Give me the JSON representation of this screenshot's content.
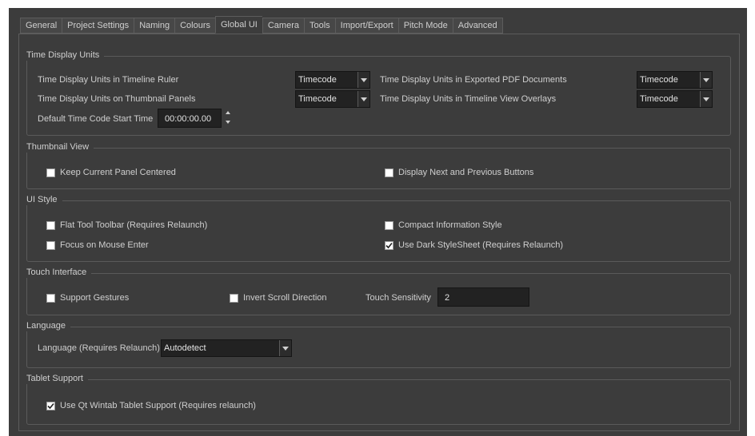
{
  "tabs": [
    "General",
    "Project Settings",
    "Naming",
    "Colours",
    "Global UI",
    "Camera",
    "Tools",
    "Import/Export",
    "Pitch Mode",
    "Advanced"
  ],
  "active_tab": "Global UI",
  "time_display": {
    "title": "Time Display Units",
    "ruler_label": "Time Display Units in Timeline Ruler",
    "ruler_value": "Timecode",
    "thumb_label": "Time Display Units on Thumbnail Panels",
    "thumb_value": "Timecode",
    "pdf_label": "Time Display Units in Exported PDF Documents",
    "pdf_value": "Timecode",
    "overlay_label": "Time Display Units in Timeline View Overlays",
    "overlay_value": "Timecode",
    "start_label": "Default Time Code Start Time",
    "start_value": "00:00:00.00"
  },
  "thumbnail_view": {
    "title": "Thumbnail View",
    "keep_centered": {
      "label": "Keep Current Panel Centered",
      "checked": false
    },
    "display_buttons": {
      "label": "Display Next and Previous Buttons",
      "checked": false
    }
  },
  "ui_style": {
    "title": "UI Style",
    "flat_toolbar": {
      "label": "Flat Tool Toolbar (Requires Relaunch)",
      "checked": false
    },
    "compact_info": {
      "label": "Compact Information Style",
      "checked": false
    },
    "focus_mouse": {
      "label": "Focus on Mouse Enter",
      "checked": false
    },
    "dark_stylesheet": {
      "label": "Use Dark StyleSheet (Requires Relaunch)",
      "checked": true
    }
  },
  "touch": {
    "title": "Touch Interface",
    "gestures": {
      "label": "Support Gestures",
      "checked": false
    },
    "invert_scroll": {
      "label": "Invert Scroll Direction",
      "checked": false
    },
    "sensitivity_label": "Touch Sensitivity",
    "sensitivity_value": "2"
  },
  "language": {
    "title": "Language",
    "label": "Language (Requires Relaunch)",
    "value": "Autodetect"
  },
  "tablet": {
    "title": "Tablet Support",
    "wintab": {
      "label": "Use Qt Wintab Tablet Support (Requires relaunch)",
      "checked": true
    }
  },
  "colors": {
    "window_bg": "#3c3c3c",
    "field_bg": "#222222",
    "text": "#cfcfcf",
    "border": "#5a5a5a"
  }
}
